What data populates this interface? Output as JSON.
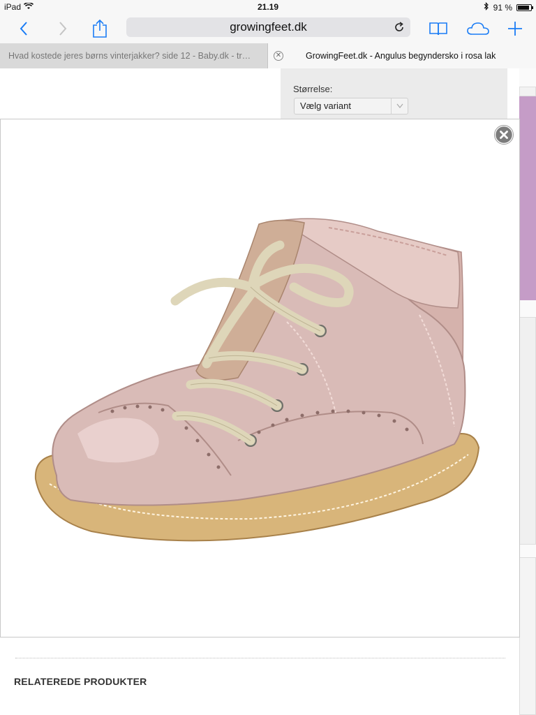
{
  "status_bar": {
    "device": "iPad",
    "time": "21.19",
    "battery": "91 %",
    "battery_level": 0.91
  },
  "toolbar": {
    "url": "growingfeet.dk"
  },
  "tabs": [
    {
      "label": "Hvad kostede jeres børns vinterjakker? side 12 - Baby.dk - tr…",
      "active": false
    },
    {
      "label": "GrowingFeet.dk - Angulus begyndersko i rosa lak",
      "active": true
    }
  ],
  "product": {
    "size_label": "Størrelse:",
    "variant_select": "Vælg variant"
  },
  "related": {
    "title": "RELATEREDE PRODUKTER"
  },
  "colors": {
    "accent": "#1a7cf5",
    "side_pink": "#c59cc7",
    "shoe_pink": "#d7b8b4",
    "sole_tan": "#d8b57a"
  }
}
